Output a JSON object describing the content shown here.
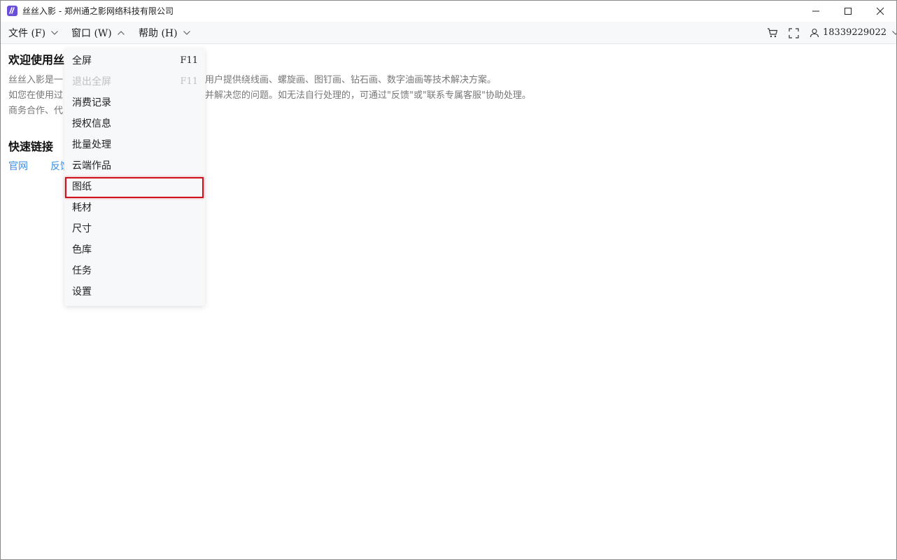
{
  "window": {
    "title": "丝丝入影 - 郑州通之影网络科技有限公司",
    "logo_icon": "app-logo-icon",
    "controls": [
      "minimize-icon",
      "maximize-icon",
      "close-icon"
    ]
  },
  "menubar": {
    "file": "文件 (F)",
    "window": "窗口 (W)",
    "help": "帮助 (H)",
    "user": "18339229022"
  },
  "content": {
    "welcome_title": "欢迎使用丝",
    "para1_left": "丝丝入影是一",
    "para1_right": "于为用户提供绕线画、螺旋画、图钉画、钻石画、数字油画等技术解决方案。",
    "para2_left": "如您在使用过",
    "para2_right": "查找并解决您的问题。如无法自行处理的，可通过\"反馈\"或\"联系专属客服\"协助处理。",
    "para3_left": "商务合作、代",
    "para3_right": "。",
    "links_title": "快速链接",
    "link1": "官网",
    "link2": "反馈"
  },
  "dropdown": {
    "items": [
      {
        "label": "全屏",
        "shortcut": "F11",
        "disabled": false
      },
      {
        "label": "退出全屏",
        "shortcut": "F11",
        "disabled": true
      },
      {
        "label": "消费记录",
        "shortcut": "",
        "disabled": false
      },
      {
        "label": "授权信息",
        "shortcut": "",
        "disabled": false
      },
      {
        "label": "批量处理",
        "shortcut": "",
        "disabled": false
      },
      {
        "label": "云端作品",
        "shortcut": "",
        "disabled": false
      },
      {
        "label": "图纸",
        "shortcut": "",
        "disabled": false
      },
      {
        "label": "耗材",
        "shortcut": "",
        "disabled": false
      },
      {
        "label": "尺寸",
        "shortcut": "",
        "disabled": false
      },
      {
        "label": "色库",
        "shortcut": "",
        "disabled": false
      },
      {
        "label": "任务",
        "shortcut": "",
        "disabled": false
      },
      {
        "label": "设置",
        "shortcut": "",
        "disabled": false
      }
    ],
    "highlighted_index": 6
  },
  "colors": {
    "accent_link": "#3a8ee6",
    "highlight": "#d0111b",
    "logo": "#6b4fd8",
    "disabled_text": "#c0c0c0"
  }
}
